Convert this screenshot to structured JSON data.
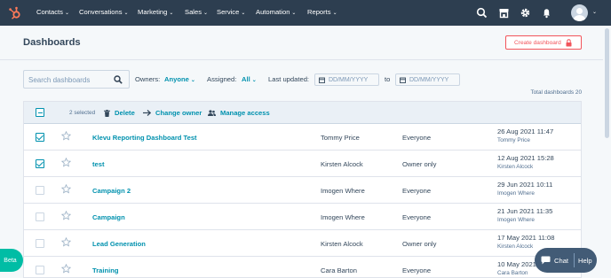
{
  "nav": {
    "items": [
      {
        "label": "Contacts"
      },
      {
        "label": "Conversations"
      },
      {
        "label": "Marketing"
      },
      {
        "label": "Sales"
      },
      {
        "label": "Service"
      },
      {
        "label": "Automation"
      },
      {
        "label": "Reports"
      }
    ],
    "icons": [
      "search-icon",
      "marketplace-icon",
      "gear-icon",
      "bell-icon"
    ]
  },
  "header": {
    "title": "Dashboards",
    "create_label": "Create dashboard"
  },
  "filters": {
    "search_placeholder": "Search dashboards",
    "owners_label": "Owners:",
    "owners_value": "Anyone",
    "assigned_label": "Assigned:",
    "assigned_value": "All",
    "updated_label": "Last updated:",
    "date_from_placeholder": "DD/MM/YYYY",
    "to_label": "to",
    "date_to_placeholder": "DD/MM/YYYY",
    "total_label": "Total dashboards 20"
  },
  "bulk": {
    "selected": "2 selected",
    "delete": "Delete",
    "change_owner": "Change owner",
    "manage_access": "Manage access"
  },
  "rows": [
    {
      "name": "Klevu Reporting Dashboard Test",
      "owner": "Tommy Price",
      "assigned": "Everyone",
      "updated": "26 Aug 2021 11:47",
      "updated_by": "Tommy Price",
      "checked": true
    },
    {
      "name": "test",
      "owner": "Kirsten Alcock",
      "assigned": "Owner only",
      "updated": "12 Aug 2021 15:28",
      "updated_by": "Kirsten Alcock",
      "checked": true
    },
    {
      "name": "Campaign 2",
      "owner": "Imogen Where",
      "assigned": "Everyone",
      "updated": "29 Jun 2021 10:11",
      "updated_by": "Imogen Where",
      "checked": false
    },
    {
      "name": "Campaign",
      "owner": "Imogen Where",
      "assigned": "Everyone",
      "updated": "21 Jun 2021 11:35",
      "updated_by": "Imogen Where",
      "checked": false
    },
    {
      "name": "Lead Generation",
      "owner": "Kirsten Alcock",
      "assigned": "Owner only",
      "updated": "17 May 2021 11:08",
      "updated_by": "Kirsten Alcock",
      "checked": false
    },
    {
      "name": "Training",
      "owner": "Cara Barton",
      "assigned": "Everyone",
      "updated": "10 May 2021",
      "updated_by": "Cara Barton",
      "checked": false
    }
  ],
  "floating": {
    "beta": "Beta",
    "chat": "Chat",
    "help": "Help"
  },
  "colors": {
    "nav_bg": "#2d3e50",
    "link": "#0091ae",
    "accent": "#f2545b",
    "beta": "#00bda5",
    "chat_bg": "#425b76"
  }
}
